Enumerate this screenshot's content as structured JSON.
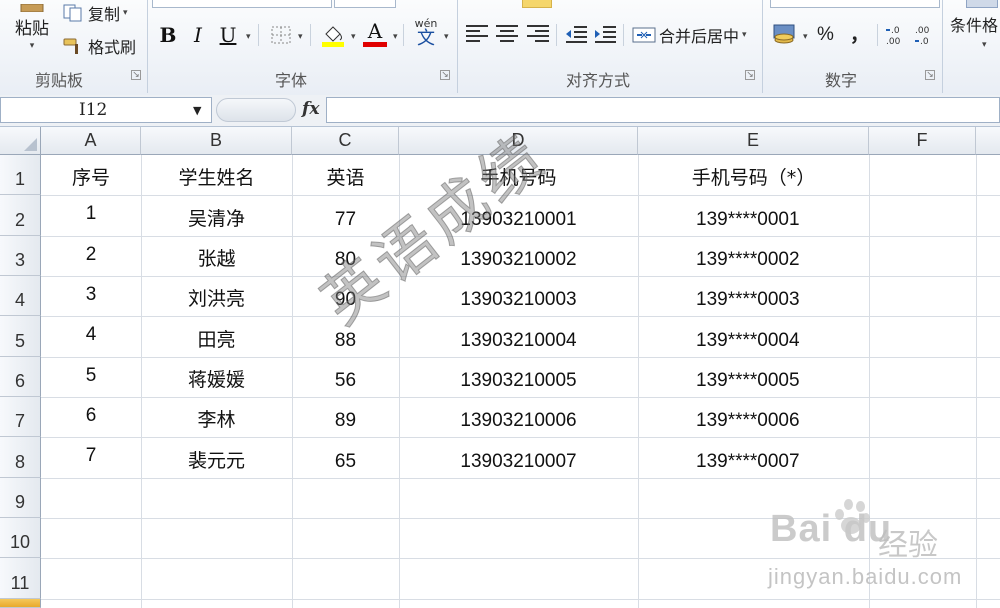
{
  "ribbon": {
    "clipboard": {
      "paste_label": "粘贴",
      "copy_label": "复制",
      "format_painter_label": "格式刷",
      "group_label": "剪贴板"
    },
    "font": {
      "bold": "B",
      "italic": "I",
      "underline": "U",
      "font_color_glyph": "A",
      "phonetic_glyph": "文",
      "phonetic_top": "wén",
      "group_label": "字体",
      "fill_color": "#FFFF00",
      "font_color": "#E00000"
    },
    "alignment": {
      "merge_center_label": "合并后居中",
      "group_label": "对齐方式"
    },
    "number": {
      "percent": "%",
      "comma": "，",
      "group_label": "数字"
    },
    "styles": {
      "conditional_format_label": "条件格"
    }
  },
  "formula_bar": {
    "name_box": "I12",
    "fx_label": "fx",
    "content": ""
  },
  "sheet": {
    "columns": [
      "A",
      "B",
      "C",
      "D",
      "E",
      "F"
    ],
    "rows": [
      "1",
      "2",
      "3",
      "4",
      "5",
      "6",
      "7",
      "8",
      "9",
      "10",
      "11"
    ],
    "header_row": [
      "序号",
      "学生姓名",
      "英语",
      "手机号码",
      "手机号码（*）"
    ],
    "data": [
      [
        "1",
        "吴清净",
        "77",
        "13903210001",
        "139****0001"
      ],
      [
        "2",
        "张越",
        "80",
        "13903210002",
        "139****0002"
      ],
      [
        "3",
        "刘洪亮",
        "90",
        "13903210003",
        "139****0003"
      ],
      [
        "4",
        "田亮",
        "88",
        "13903210004",
        "139****0004"
      ],
      [
        "5",
        "蒋媛媛",
        "56",
        "13903210005",
        "139****0005"
      ],
      [
        "6",
        "李林",
        "89",
        "13903210006",
        "139****0006"
      ],
      [
        "7",
        "裴元元",
        "65",
        "13903210007",
        "139****0007"
      ]
    ]
  },
  "watermark": {
    "text": "英语成绩",
    "baidu_logo": "Bai du",
    "baidu_cn": "经验",
    "baidu_url": "jingyan.baidu.com"
  },
  "colors": {
    "header_bg": "#E4E9EF",
    "gridline": "#D8DDE4",
    "ribbon_bg": "#E9EEF5"
  }
}
